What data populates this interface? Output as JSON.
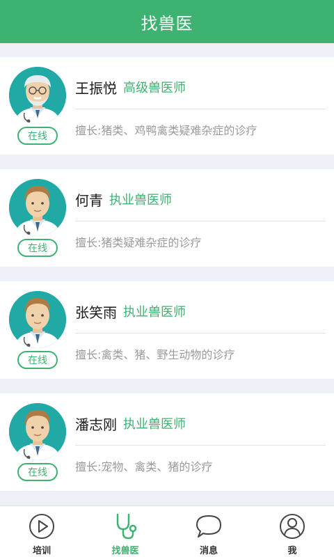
{
  "header": {
    "title": "找兽医"
  },
  "colors": {
    "brand": "#3db271",
    "avatar_bg": "#20a9a5",
    "page_bg": "#edf1f7"
  },
  "doctors": [
    {
      "name": "王振悦",
      "title": "高级兽医师",
      "status": "在线",
      "specialty": "擅长:猪类、鸡鸭禽类疑难杂症的诊疗",
      "avatar": "senior-doctor-avatar"
    },
    {
      "name": "何青",
      "title": "执业兽医师",
      "status": "在线",
      "specialty": "擅长:猪类疑难杂症的诊疗",
      "avatar": "doctor-avatar"
    },
    {
      "name": "张笑雨",
      "title": "执业兽医师",
      "status": "在线",
      "specialty": "擅长:禽类、猪、野生动物的诊疗",
      "avatar": "doctor-avatar"
    },
    {
      "name": "潘志刚",
      "title": "执业兽医师",
      "status": "在线",
      "specialty": "擅长:宠物、禽类、猪的诊疗",
      "avatar": "doctor-avatar"
    }
  ],
  "tabbar": {
    "items": [
      {
        "label": "培训",
        "icon": "play-circle-icon"
      },
      {
        "label": "找兽医",
        "icon": "stethoscope-icon",
        "active": true
      },
      {
        "label": "消息",
        "icon": "chat-bubble-icon"
      },
      {
        "label": "我",
        "icon": "user-icon"
      }
    ]
  }
}
